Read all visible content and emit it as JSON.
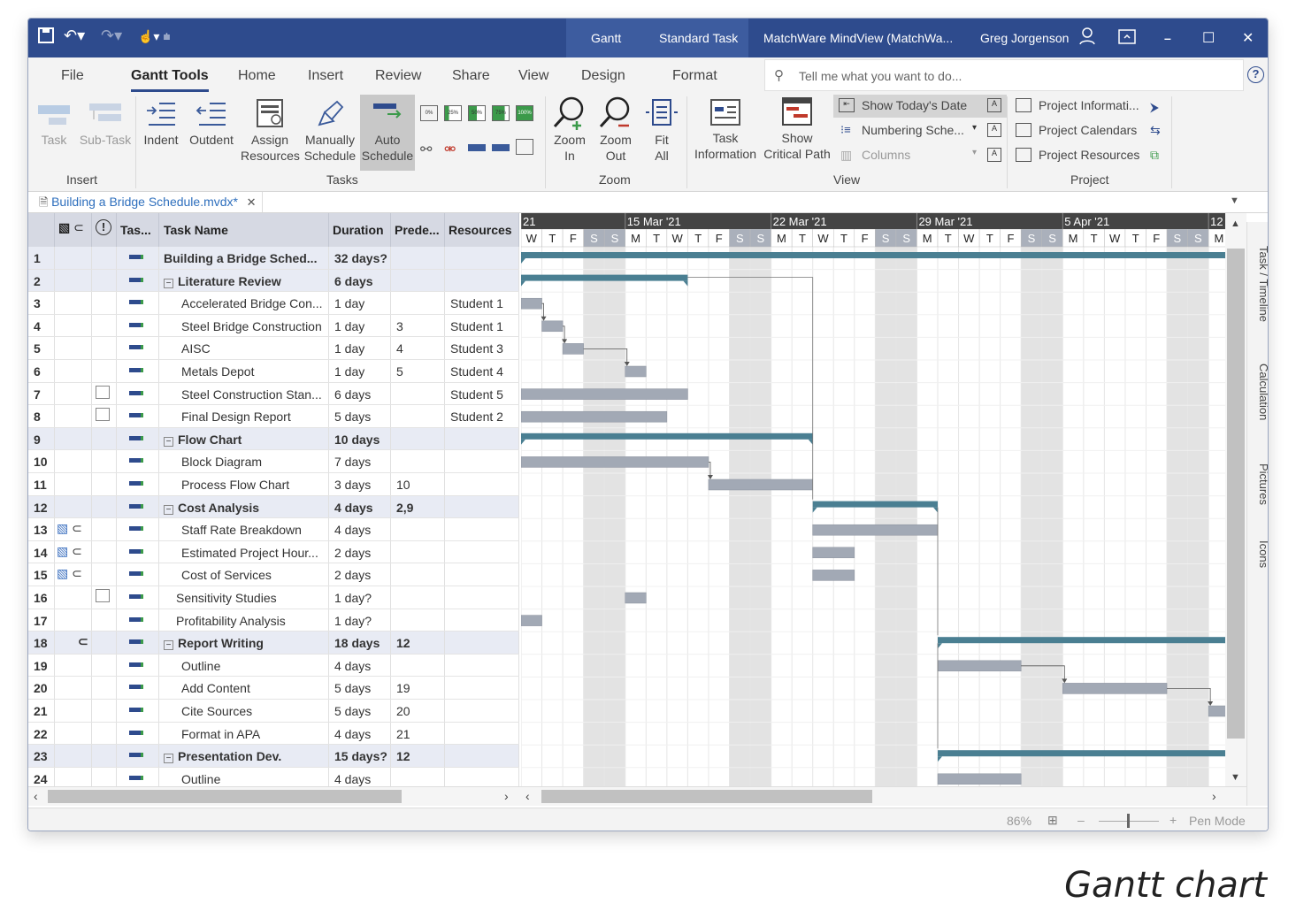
{
  "titlebar": {
    "context_tab_label": "Gantt",
    "standard_task_label": "Standard Task",
    "app_title": "MatchWare MindView (MatchWa...",
    "user_name": "Greg Jorgenson",
    "minimize": "–",
    "maximize": "☐",
    "close": "✕"
  },
  "menu_tabs": [
    "File",
    "Gantt Tools",
    "Home",
    "Insert",
    "Review",
    "Share",
    "View",
    "Design",
    "Format"
  ],
  "tell_me_placeholder": "Tell me what you want to do...",
  "help": "?",
  "ribbon": {
    "insert": {
      "task": "Task",
      "subtask": "Sub-Task",
      "group": "Insert"
    },
    "tasks": {
      "indent": "Indent",
      "outdent": "Outdent",
      "assign_1": "Assign",
      "assign_2": "Resources",
      "manual_1": "Manually",
      "manual_2": "Schedule",
      "auto_1": "Auto",
      "auto_2": "Schedule",
      "group": "Tasks"
    },
    "progress_pcts": [
      "0%",
      "25%",
      "50%",
      "75%",
      "100%"
    ],
    "zoom": {
      "zin_1": "Zoom",
      "zin_2": "In",
      "zout_1": "Zoom",
      "zout_2": "Out",
      "fit_1": "Fit",
      "fit_2": "All",
      "group": "Zoom"
    },
    "view": {
      "taskinfo_1": "Task",
      "taskinfo_2": "Information",
      "crit_1": "Show",
      "crit_2": "Critical Path",
      "today": "Show Today's Date",
      "numbering": "Numbering Sche...",
      "columns": "Columns",
      "group": "View"
    },
    "project": {
      "info": "Project Informati...",
      "cal": "Project Calendars",
      "res": "Project Resources",
      "group": "Project"
    }
  },
  "doc_tab": {
    "name": "Building a Bridge Schedule.mvdx*",
    "close": "✕"
  },
  "grid_headers": {
    "mode": "Tas...",
    "name": "Task Name",
    "duration": "Duration",
    "pred": "Prede...",
    "resources": "Resources"
  },
  "tasks": [
    {
      "id": "1",
      "name": "Building a Bridge Sched...",
      "duration": "32 days?",
      "pred": "",
      "res": "",
      "summary": true,
      "level": 0,
      "icons": ""
    },
    {
      "id": "2",
      "name": "Literature Review",
      "duration": "6 days",
      "pred": "",
      "res": "",
      "summary": true,
      "level": 1,
      "icons": ""
    },
    {
      "id": "3",
      "name": "Accelerated Bridge Con...",
      "duration": "1 day",
      "pred": "",
      "res": "Student 1",
      "summary": false,
      "level": 2,
      "icons": ""
    },
    {
      "id": "4",
      "name": "Steel Bridge Construction",
      "duration": "1 day",
      "pred": "3",
      "res": "Student 1",
      "summary": false,
      "level": 2,
      "icons": ""
    },
    {
      "id": "5",
      "name": "AISC",
      "duration": "1 day",
      "pred": "4",
      "res": "Student 3",
      "summary": false,
      "level": 2,
      "icons": ""
    },
    {
      "id": "6",
      "name": "Metals Depot",
      "duration": "1 day",
      "pred": "5",
      "res": "Student 4",
      "summary": false,
      "level": 2,
      "icons": ""
    },
    {
      "id": "7",
      "name": "Steel Construction Stan...",
      "duration": "6 days",
      "pred": "",
      "res": "Student 5",
      "summary": false,
      "level": 2,
      "icons": "cal"
    },
    {
      "id": "8",
      "name": "Final Design Report",
      "duration": "5 days",
      "pred": "",
      "res": "Student 2",
      "summary": false,
      "level": 2,
      "icons": "cal"
    },
    {
      "id": "9",
      "name": "Flow Chart",
      "duration": "10 days",
      "pred": "",
      "res": "",
      "summary": true,
      "level": 1,
      "icons": ""
    },
    {
      "id": "10",
      "name": "Block Diagram",
      "duration": "7 days",
      "pred": "",
      "res": "",
      "summary": false,
      "level": 2,
      "icons": ""
    },
    {
      "id": "11",
      "name": "Process Flow Chart",
      "duration": "3 days",
      "pred": "10",
      "res": "",
      "summary": false,
      "level": 2,
      "icons": ""
    },
    {
      "id": "12",
      "name": "Cost Analysis",
      "duration": "4 days",
      "pred": "2,9",
      "res": "",
      "summary": true,
      "level": 1,
      "icons": ""
    },
    {
      "id": "13",
      "name": "Staff Rate Breakdown",
      "duration": "4 days",
      "pred": "",
      "res": "",
      "summary": false,
      "level": 2,
      "icons": "imgclip"
    },
    {
      "id": "14",
      "name": "Estimated Project Hour...",
      "duration": "2 days",
      "pred": "",
      "res": "",
      "summary": false,
      "level": 2,
      "icons": "imgclip"
    },
    {
      "id": "15",
      "name": "Cost of Services",
      "duration": "2 days",
      "pred": "",
      "res": "",
      "summary": false,
      "level": 2,
      "icons": "imgclip"
    },
    {
      "id": "16",
      "name": "Sensitivity Studies",
      "duration": "1 day?",
      "pred": "",
      "res": "",
      "summary": false,
      "level": 1,
      "icons": "cal"
    },
    {
      "id": "17",
      "name": "Profitability Analysis",
      "duration": "1 day?",
      "pred": "",
      "res": "",
      "summary": false,
      "level": 1,
      "icons": ""
    },
    {
      "id": "18",
      "name": "Report Writing",
      "duration": "18 days",
      "pred": "12",
      "res": "",
      "summary": true,
      "level": 1,
      "icons": "clip"
    },
    {
      "id": "19",
      "name": "Outline",
      "duration": "4 days",
      "pred": "",
      "res": "",
      "summary": false,
      "level": 2,
      "icons": ""
    },
    {
      "id": "20",
      "name": "Add Content",
      "duration": "5 days",
      "pred": "19",
      "res": "",
      "summary": false,
      "level": 2,
      "icons": ""
    },
    {
      "id": "21",
      "name": "Cite Sources",
      "duration": "5 days",
      "pred": "20",
      "res": "",
      "summary": false,
      "level": 2,
      "icons": ""
    },
    {
      "id": "22",
      "name": "Format in APA",
      "duration": "4 days",
      "pred": "21",
      "res": "",
      "summary": false,
      "level": 2,
      "icons": ""
    },
    {
      "id": "23",
      "name": "Presentation Dev.",
      "duration": "15 days?",
      "pred": "12",
      "res": "",
      "summary": true,
      "level": 1,
      "icons": ""
    },
    {
      "id": "24",
      "name": "Outline",
      "duration": "4 days",
      "pred": "",
      "res": "",
      "summary": false,
      "level": 2,
      "icons": ""
    }
  ],
  "timeline": {
    "weeks": [
      "21",
      "15 Mar '21",
      "22 Mar '21",
      "29 Mar '21",
      "5 Apr '21",
      "12"
    ],
    "day_letters": [
      "W",
      "T",
      "F",
      "S",
      "S",
      "M",
      "T",
      "W",
      "T",
      "F",
      "S",
      "S",
      "M",
      "T",
      "W",
      "T",
      "F",
      "S",
      "S",
      "M",
      "T",
      "W",
      "T",
      "F",
      "S",
      "S",
      "M",
      "T",
      "W",
      "T",
      "F",
      "S",
      "S",
      "M"
    ],
    "bars": [
      {
        "row": 0,
        "start": 0,
        "end": 34,
        "kind": "summary"
      },
      {
        "row": 1,
        "start": 0,
        "end": 8,
        "kind": "summary"
      },
      {
        "row": 2,
        "start": 0,
        "end": 1,
        "kind": "task"
      },
      {
        "row": 3,
        "start": 1,
        "end": 2,
        "kind": "task"
      },
      {
        "row": 4,
        "start": 2,
        "end": 3,
        "kind": "task"
      },
      {
        "row": 5,
        "start": 5,
        "end": 6,
        "kind": "task"
      },
      {
        "row": 6,
        "start": 0,
        "end": 8,
        "kind": "task"
      },
      {
        "row": 7,
        "start": 0,
        "end": 7,
        "kind": "task"
      },
      {
        "row": 8,
        "start": 0,
        "end": 14,
        "kind": "summary"
      },
      {
        "row": 9,
        "start": 0,
        "end": 9,
        "kind": "task"
      },
      {
        "row": 10,
        "start": 9,
        "end": 14,
        "kind": "task"
      },
      {
        "row": 11,
        "start": 14,
        "end": 20,
        "kind": "summary"
      },
      {
        "row": 12,
        "start": 14,
        "end": 20,
        "kind": "task"
      },
      {
        "row": 13,
        "start": 14,
        "end": 16,
        "kind": "task"
      },
      {
        "row": 14,
        "start": 14,
        "end": 16,
        "kind": "task"
      },
      {
        "row": 15,
        "start": 5,
        "end": 6,
        "kind": "task"
      },
      {
        "row": 16,
        "start": 0,
        "end": 1,
        "kind": "task"
      },
      {
        "row": 17,
        "start": 20,
        "end": 34,
        "kind": "summary"
      },
      {
        "row": 18,
        "start": 20,
        "end": 24,
        "kind": "task"
      },
      {
        "row": 19,
        "start": 26,
        "end": 31,
        "kind": "task"
      },
      {
        "row": 20,
        "start": 33,
        "end": 34,
        "kind": "task"
      },
      {
        "row": 22,
        "start": 20,
        "end": 34,
        "kind": "summary"
      },
      {
        "row": 23,
        "start": 20,
        "end": 24,
        "kind": "task"
      }
    ]
  },
  "side_tabs": [
    "Task / Timeline",
    "Calculation",
    "Pictures",
    "Icons"
  ],
  "status": {
    "zoom": "86%",
    "minus": "–",
    "plus": "+",
    "pen_mode": "Pen Mode"
  },
  "caption": "Gantt chart",
  "colors": {
    "title_bg": "#2e4b8d",
    "summary_bar": "#4a7f92",
    "task_bar": "#a2a9b5",
    "weekend": "#e3e3e3"
  }
}
